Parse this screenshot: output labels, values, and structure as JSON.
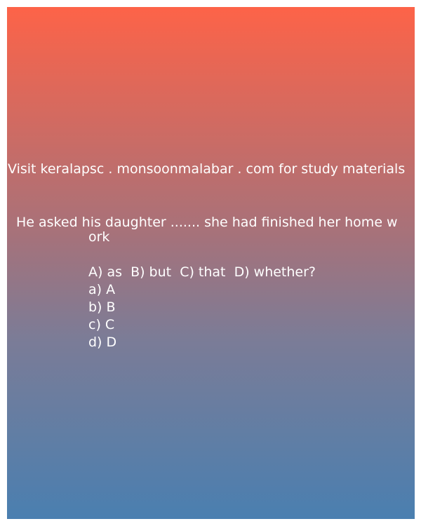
{
  "visit_text": "Visit keralapsc . monsoonmalabar . com for study materials",
  "question": {
    "line1": "He asked his daughter ....... she had finished her home w",
    "line2": "ork",
    "choices_line": "A) as  B) but  C) that  D) whether?",
    "options": [
      "a) A",
      "b) B",
      "c) C",
      "d) D"
    ]
  },
  "colors": {
    "gradient_top": "#fd6348",
    "gradient_bottom": "#4a7fb0",
    "text": "#ffffff"
  }
}
